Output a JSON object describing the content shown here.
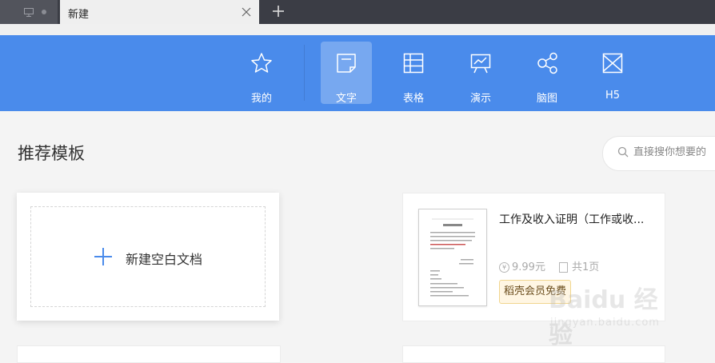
{
  "tabs": [
    {
      "title": "新建"
    }
  ],
  "nav": {
    "items": [
      {
        "label": "我的",
        "icon": "star-icon"
      },
      {
        "label": "文字",
        "icon": "document-icon",
        "active": true
      },
      {
        "label": "表格",
        "icon": "spreadsheet-icon"
      },
      {
        "label": "演示",
        "icon": "presentation-icon"
      },
      {
        "label": "脑图",
        "icon": "mindmap-icon"
      },
      {
        "label": "H5",
        "icon": "h5-icon"
      }
    ]
  },
  "section": {
    "title": "推荐模板"
  },
  "search": {
    "placeholder": "直接搜你想要的"
  },
  "blank_card": {
    "label": "新建空白文档"
  },
  "template_card": {
    "title": "工作及收入证明（工作或收...",
    "price": "9.99元",
    "pages": "共1页",
    "badge": "稻壳会员免费"
  },
  "watermark": {
    "text": "Baidu 经验",
    "url": "jingyan.baidu.com"
  },
  "colors": {
    "header": "#4a8beb",
    "titlebar": "#3b3d45"
  }
}
